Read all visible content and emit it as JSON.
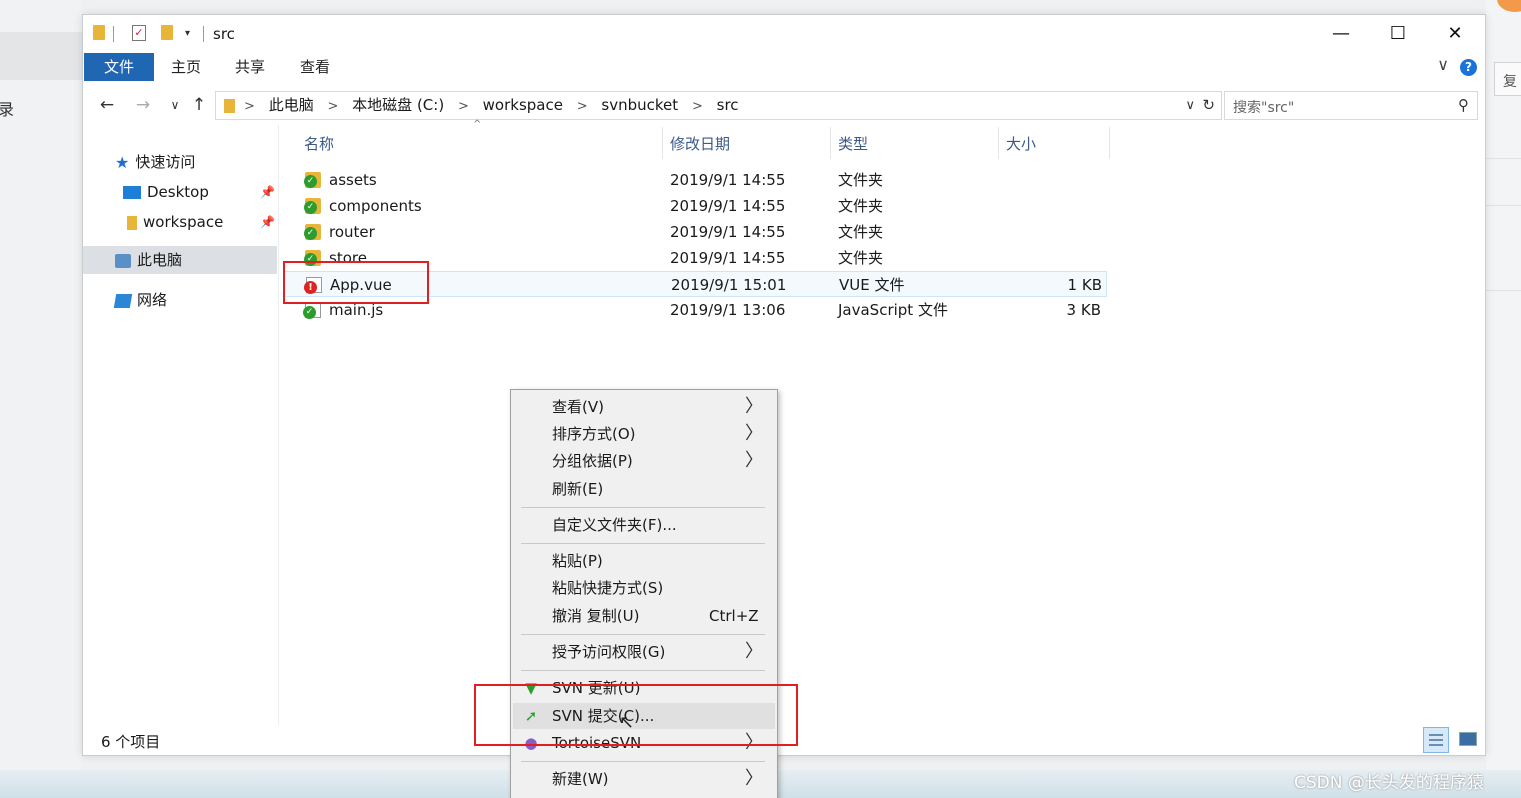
{
  "background": {
    "left_label": "录",
    "right_button": "复"
  },
  "window": {
    "title": "src",
    "min_icon": "minimize-icon",
    "max_icon": "maximize-icon",
    "close_icon": "close-icon",
    "min_glyph": "—",
    "max_glyph": "☐",
    "close_glyph": "✕"
  },
  "ribbon": {
    "tabs": [
      "文件",
      "主页",
      "共享",
      "查看"
    ],
    "help": "?",
    "expand_glyph": "∨"
  },
  "nav": {
    "back": "←",
    "forward": "→",
    "recent": "∨",
    "up": "↑",
    "breadcrumbs": [
      "此电脑",
      "本地磁盘 (C:)",
      "workspace",
      "svnbucket",
      "src"
    ],
    "separator": ">",
    "dropdown": "∨",
    "refresh": "↻",
    "search_placeholder": "搜索\"src\"",
    "search_glyph": "⚲"
  },
  "sidebar": {
    "quick_access": "快速访问",
    "items": [
      {
        "label": "Desktop",
        "icon": "desktop-icon"
      },
      {
        "label": "workspace",
        "icon": "folder-icon"
      }
    ],
    "this_pc": "此电脑",
    "network": "网络",
    "pin_glyph": "📌"
  },
  "columns": {
    "name": "名称",
    "date": "修改日期",
    "type": "类型",
    "size": "大小"
  },
  "files": [
    {
      "name": "assets",
      "date": "2019/9/1 14:55",
      "type": "文件夹",
      "size": "",
      "status": "svn-normal"
    },
    {
      "name": "components",
      "date": "2019/9/1 14:55",
      "type": "文件夹",
      "size": "",
      "status": "svn-normal"
    },
    {
      "name": "router",
      "date": "2019/9/1 14:55",
      "type": "文件夹",
      "size": "",
      "status": "svn-normal"
    },
    {
      "name": "store",
      "date": "2019/9/1 14:55",
      "type": "文件夹",
      "size": "",
      "status": "svn-normal"
    },
    {
      "name": "App.vue",
      "date": "2019/9/1 15:01",
      "type": "VUE 文件",
      "size": "1 KB",
      "status": "svn-modified"
    },
    {
      "name": "main.js",
      "date": "2019/9/1 13:06",
      "type": "JavaScript 文件",
      "size": "3 KB",
      "status": "svn-normal"
    }
  ],
  "status_bar": {
    "item_count": "6 个项目"
  },
  "context_menu": {
    "items": [
      {
        "label": "查看(V)",
        "submenu": true
      },
      {
        "label": "排序方式(O)",
        "submenu": true
      },
      {
        "label": "分组依据(P)",
        "submenu": true
      },
      {
        "label": "刷新(E)",
        "submenu": false
      },
      {
        "label": "自定义文件夹(F)...",
        "submenu": false
      },
      {
        "label": "粘贴(P)",
        "submenu": false
      },
      {
        "label": "粘贴快捷方式(S)",
        "submenu": false
      },
      {
        "label": "撤消 复制(U)",
        "submenu": false,
        "shortcut": "Ctrl+Z"
      },
      {
        "label": "授予访问权限(G)",
        "submenu": true
      },
      {
        "label": "SVN 更新(U)",
        "submenu": false,
        "icon": "svn-update-icon"
      },
      {
        "label": "SVN 提交(C)...",
        "submenu": false,
        "icon": "svn-commit-icon",
        "highlighted": true
      },
      {
        "label": "TortoiseSVN",
        "submenu": true,
        "icon": "tortoisesvn-icon"
      },
      {
        "label": "新建(W)",
        "submenu": true
      }
    ],
    "arrow": "〉"
  },
  "watermark": "CSDN @长头发的程序猿",
  "colors": {
    "file_tab": "#1f66b3",
    "highlight_box": "#e02020",
    "svn_ok": "#2c9c2c",
    "svn_modified": "#d22222"
  }
}
